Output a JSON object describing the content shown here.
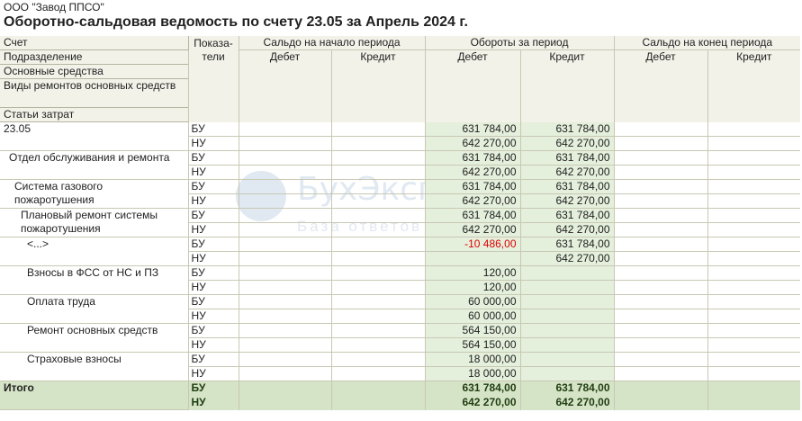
{
  "org": "ООО \"Завод ППСО\"",
  "title": "Оборотно-сальдовая ведомость по счету 23.05 за Апрель 2024 г.",
  "watermark": {
    "brand": "БухЭксперт",
    "tagline": "База ответов по учету"
  },
  "headers": {
    "dims": [
      "Счет",
      "Подразделение",
      "Основные средства",
      "Виды ремонтов основных средств",
      "Статьи затрат"
    ],
    "ind": "Показа-тели",
    "groups": [
      "Сальдо на начало периода",
      "Обороты за период",
      "Сальдо на конец периода"
    ],
    "debit": "Дебет",
    "credit": "Кредит"
  },
  "rows": [
    {
      "name": "23.05",
      "ind": [
        "БУ",
        "НУ"
      ],
      "od": [
        "631 784,00",
        "642 270,00"
      ],
      "oc": [
        "631 784,00",
        "642 270,00"
      ]
    },
    {
      "name": "Отдел обслуживания и ремонта",
      "ind": [
        "БУ",
        "НУ"
      ],
      "od": [
        "631 784,00",
        "642 270,00"
      ],
      "oc": [
        "631 784,00",
        "642 270,00"
      ]
    },
    {
      "name": "Система газового пожаротушения",
      "ind": [
        "БУ",
        "НУ"
      ],
      "od": [
        "631 784,00",
        "642 270,00"
      ],
      "oc": [
        "631 784,00",
        "642 270,00"
      ]
    },
    {
      "name": "Плановый ремонт системы пожаротушения",
      "ind": [
        "БУ",
        "НУ"
      ],
      "od": [
        "631 784,00",
        "642 270,00"
      ],
      "oc": [
        "631 784,00",
        "642 270,00"
      ]
    },
    {
      "name": "<...>",
      "ind": [
        "БУ",
        "НУ"
      ],
      "od": [
        "-10 486,00",
        ""
      ],
      "oc": [
        "631 784,00",
        "642 270,00"
      ]
    },
    {
      "name": "Взносы в ФСС от НС и ПЗ",
      "ind": [
        "БУ",
        "НУ"
      ],
      "od": [
        "120,00",
        "120,00"
      ],
      "oc": [
        "",
        ""
      ]
    },
    {
      "name": "Оплата труда",
      "ind": [
        "БУ",
        "НУ"
      ],
      "od": [
        "60 000,00",
        "60 000,00"
      ],
      "oc": [
        "",
        ""
      ]
    },
    {
      "name": "Ремонт основных средств",
      "ind": [
        "БУ",
        "НУ"
      ],
      "od": [
        "564 150,00",
        "564 150,00"
      ],
      "oc": [
        "",
        ""
      ]
    },
    {
      "name": "Страховые взносы",
      "ind": [
        "БУ",
        "НУ"
      ],
      "od": [
        "18 000,00",
        "18 000,00"
      ],
      "oc": [
        "",
        ""
      ]
    }
  ],
  "total": {
    "name": "Итого",
    "ind": [
      "БУ",
      "НУ"
    ],
    "od": [
      "631 784,00",
      "642 270,00"
    ],
    "oc": [
      "631 784,00",
      "642 270,00"
    ]
  },
  "colors": {
    "header_bg": "#f2f2e9",
    "stripe_bg": "#e4efdc",
    "total_bg": "#d5e3c6",
    "negative": "#e00000"
  }
}
